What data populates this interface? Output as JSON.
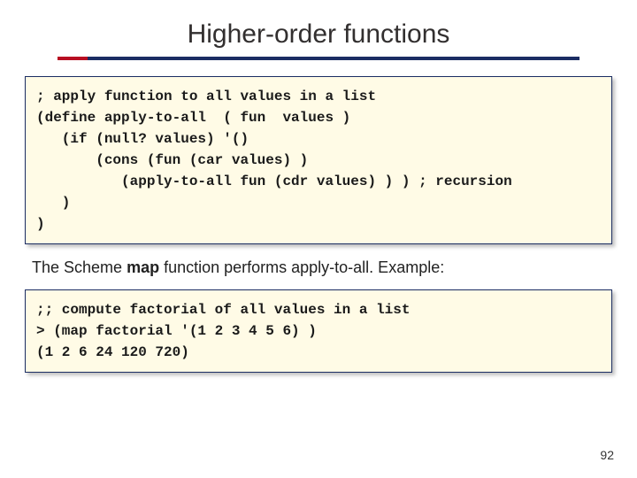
{
  "title": "Higher-order functions",
  "code1": {
    "l1": "; apply function to all values in a list",
    "l2": "(define apply-to-all  ( fun  values )",
    "l3": "   (if (null? values) '()",
    "l4": "       (cons (fun (car values) )",
    "l5": "          (apply-to-all fun (cdr values) ) ) ; recursion",
    "l6": "   )",
    "l7": ")"
  },
  "body": {
    "pre": "The Scheme ",
    "bold": "map",
    "post": " function performs apply-to-all.  Example:"
  },
  "code2": {
    "l1": ";; compute factorial of all values in a list",
    "l2": "> (map factorial '(1 2 3 4 5 6) )",
    "l3": "(1 2 6 24 120 720)"
  },
  "page": "92"
}
